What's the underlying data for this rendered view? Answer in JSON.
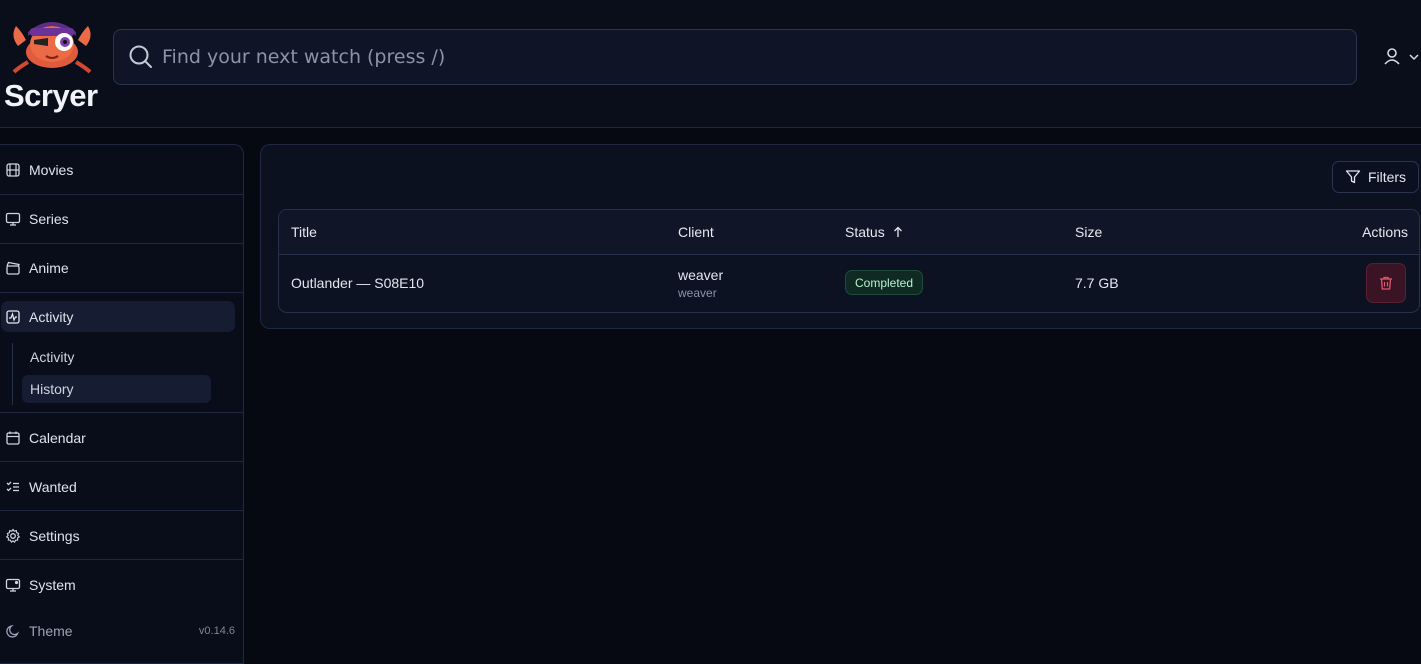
{
  "app": {
    "brand": "Scryer"
  },
  "search": {
    "placeholder": "Find your next watch (press /)",
    "value": ""
  },
  "sidebar": {
    "items": [
      {
        "label": "Movies",
        "icon": "film-icon"
      },
      {
        "label": "Series",
        "icon": "monitor-icon"
      },
      {
        "label": "Anime",
        "icon": "clapperboard-icon"
      },
      {
        "label": "Activity",
        "icon": "activity-icon"
      },
      {
        "label": "Calendar",
        "icon": "calendar-icon"
      },
      {
        "label": "Wanted",
        "icon": "checklist-icon"
      },
      {
        "label": "Settings",
        "icon": "gear-icon"
      },
      {
        "label": "System",
        "icon": "system-monitor-icon"
      }
    ],
    "subitems": [
      {
        "label": "Activity"
      },
      {
        "label": "History"
      }
    ],
    "theme_label": "Theme",
    "version": "v0.14.6"
  },
  "toolbar": {
    "filters_label": "Filters"
  },
  "table": {
    "headers": {
      "title": "Title",
      "client": "Client",
      "status": "Status",
      "size": "Size",
      "actions": "Actions"
    },
    "status_sort": "ascending",
    "rows": [
      {
        "title": "Outlander — S08E10",
        "client": "weaver",
        "client_sub": "weaver",
        "status": "Completed",
        "size": "7.7 GB"
      }
    ]
  },
  "colors": {
    "accent": "#161d33",
    "success": "#b9f0d3",
    "danger": "#e0566e",
    "background": "#060912"
  }
}
